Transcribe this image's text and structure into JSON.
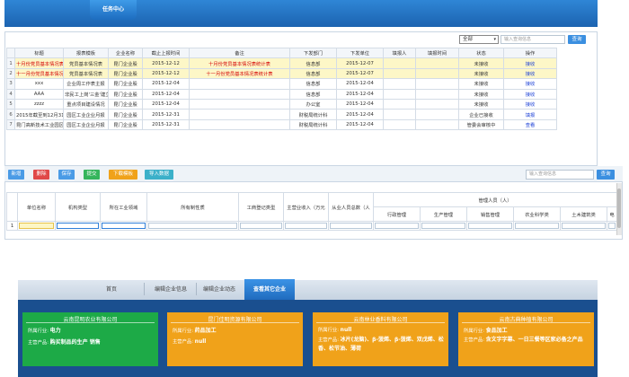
{
  "header": {
    "active_tab": "任务中心"
  },
  "task_panel": {
    "filter_select": "全部",
    "search_placeholder": "输入查询信息",
    "search_button": "查询",
    "columns": [
      "标题",
      "报表模板",
      "企业名称",
      "截止上报时间",
      "备注",
      "下发部门",
      "下发单位",
      "填报人",
      "填报时间",
      "状态",
      "操作"
    ],
    "rows": [
      {
        "n": "1",
        "title": "十月份党员基本情况表",
        "tpl": "党员基本情况表",
        "org": "昆门企业股",
        "deadline": "2015-12-12",
        "note": "十月份党员基本情况表统计表",
        "dept": "信息部",
        "unit": "2015-12-07",
        "filler": "",
        "ftime": "",
        "status": "未接收",
        "op": "接收"
      },
      {
        "n": "2",
        "title": "十一月份党员基本情况表",
        "tpl": "党员基本情况表",
        "org": "昆门企业股",
        "deadline": "2015-12-12",
        "note": "十一月份党员基本情况表统计表",
        "dept": "信息部",
        "unit": "2015-12-07",
        "filler": "",
        "ftime": "",
        "status": "未接收",
        "op": "接收"
      },
      {
        "n": "3",
        "title": "xxx",
        "tpl": "企业周工作表主报",
        "org": "昆门企业股",
        "deadline": "2015-12-04",
        "note": "",
        "dept": "信息部",
        "unit": "2015-12-04",
        "filler": "",
        "ftime": "",
        "status": "未接收",
        "op": "接收"
      },
      {
        "n": "4",
        "title": "AAA",
        "tpl": "非民工上岗'三金'建立",
        "org": "昆门企业股",
        "deadline": "2015-12-04",
        "note": "",
        "dept": "信息部",
        "unit": "2015-12-04",
        "filler": "",
        "ftime": "",
        "status": "未接收",
        "op": "接收"
      },
      {
        "n": "5",
        "title": "zzzz",
        "tpl": "重点项目建设情况",
        "org": "昆门企业股",
        "deadline": "2015-12-04",
        "note": "",
        "dept": "办公室",
        "unit": "2015-12-04",
        "filler": "",
        "ftime": "",
        "status": "未接收",
        "op": "接收"
      },
      {
        "n": "6",
        "title": "2015年截至到12月31",
        "tpl": "园区工业企业月报",
        "org": "昆门企业股",
        "deadline": "2015-12-31",
        "note": "",
        "dept": "财税局统计科",
        "unit": "2015-12-04",
        "filler": "",
        "ftime": "",
        "status": "企业已接收",
        "op": "填报"
      },
      {
        "n": "7",
        "title": "昆门高新技术工业园区",
        "tpl": "园区工业企业月报",
        "org": "昆门企业股",
        "deadline": "2015-12-31",
        "note": "",
        "dept": "财税局统计科",
        "unit": "2015-12-04",
        "filler": "",
        "ftime": "",
        "status": "管委会审核中",
        "op": "查看"
      }
    ]
  },
  "edit_panel": {
    "toolbar": {
      "add": "新增",
      "delete": "删除",
      "save": "保存",
      "submit": "提交",
      "download": "下载模板",
      "import": "导入数据"
    },
    "search_placeholder": "输入查询信息",
    "search_button": "查询",
    "columns": [
      "单位名称",
      "机构类型",
      "所在工业领域",
      "所有制性质",
      "工商登记类型",
      "主营业收入（万元",
      "从业人员总数（人"
    ],
    "group_header": "管理人员（人）",
    "sub_columns": [
      "行政管理",
      "生产管理",
      "销售管理",
      "农业科学类",
      "土木建筑类",
      "电"
    ],
    "row_number": "1"
  },
  "bottom": {
    "nav": [
      "首页",
      "编辑企业信息",
      "编辑企业动态",
      "查看其它企业"
    ],
    "cards": [
      {
        "name": "云南昆明农业有限公司",
        "industry_label": "所属行业:",
        "industry": "电力",
        "product_label": "主营产品:",
        "product": "购买制品的生产 销售",
        "color": "#1daa47"
      },
      {
        "name": "昆门佳明资源有限公司",
        "industry_label": "所属行业:",
        "industry": "药品加工",
        "product_label": "主营产品:",
        "product": "null",
        "color": "#f0a21a"
      },
      {
        "name": "云南林业香料有限公司",
        "industry_label": "所属行业:",
        "industry": "null",
        "product_label": "主营产品:",
        "product": "冰片(龙脑)、β-菠烯、β-菠烯、双戊烯、松香、松节油、薄荷",
        "color": "#f0a21a"
      },
      {
        "name": "云南古典种植有限公司",
        "industry_label": "所属行业:",
        "industry": "食品加工",
        "product_label": "主营产品:",
        "product": "含文字字幕、一日三餐等区家必备之产品",
        "color": "#f0a21a"
      }
    ]
  }
}
